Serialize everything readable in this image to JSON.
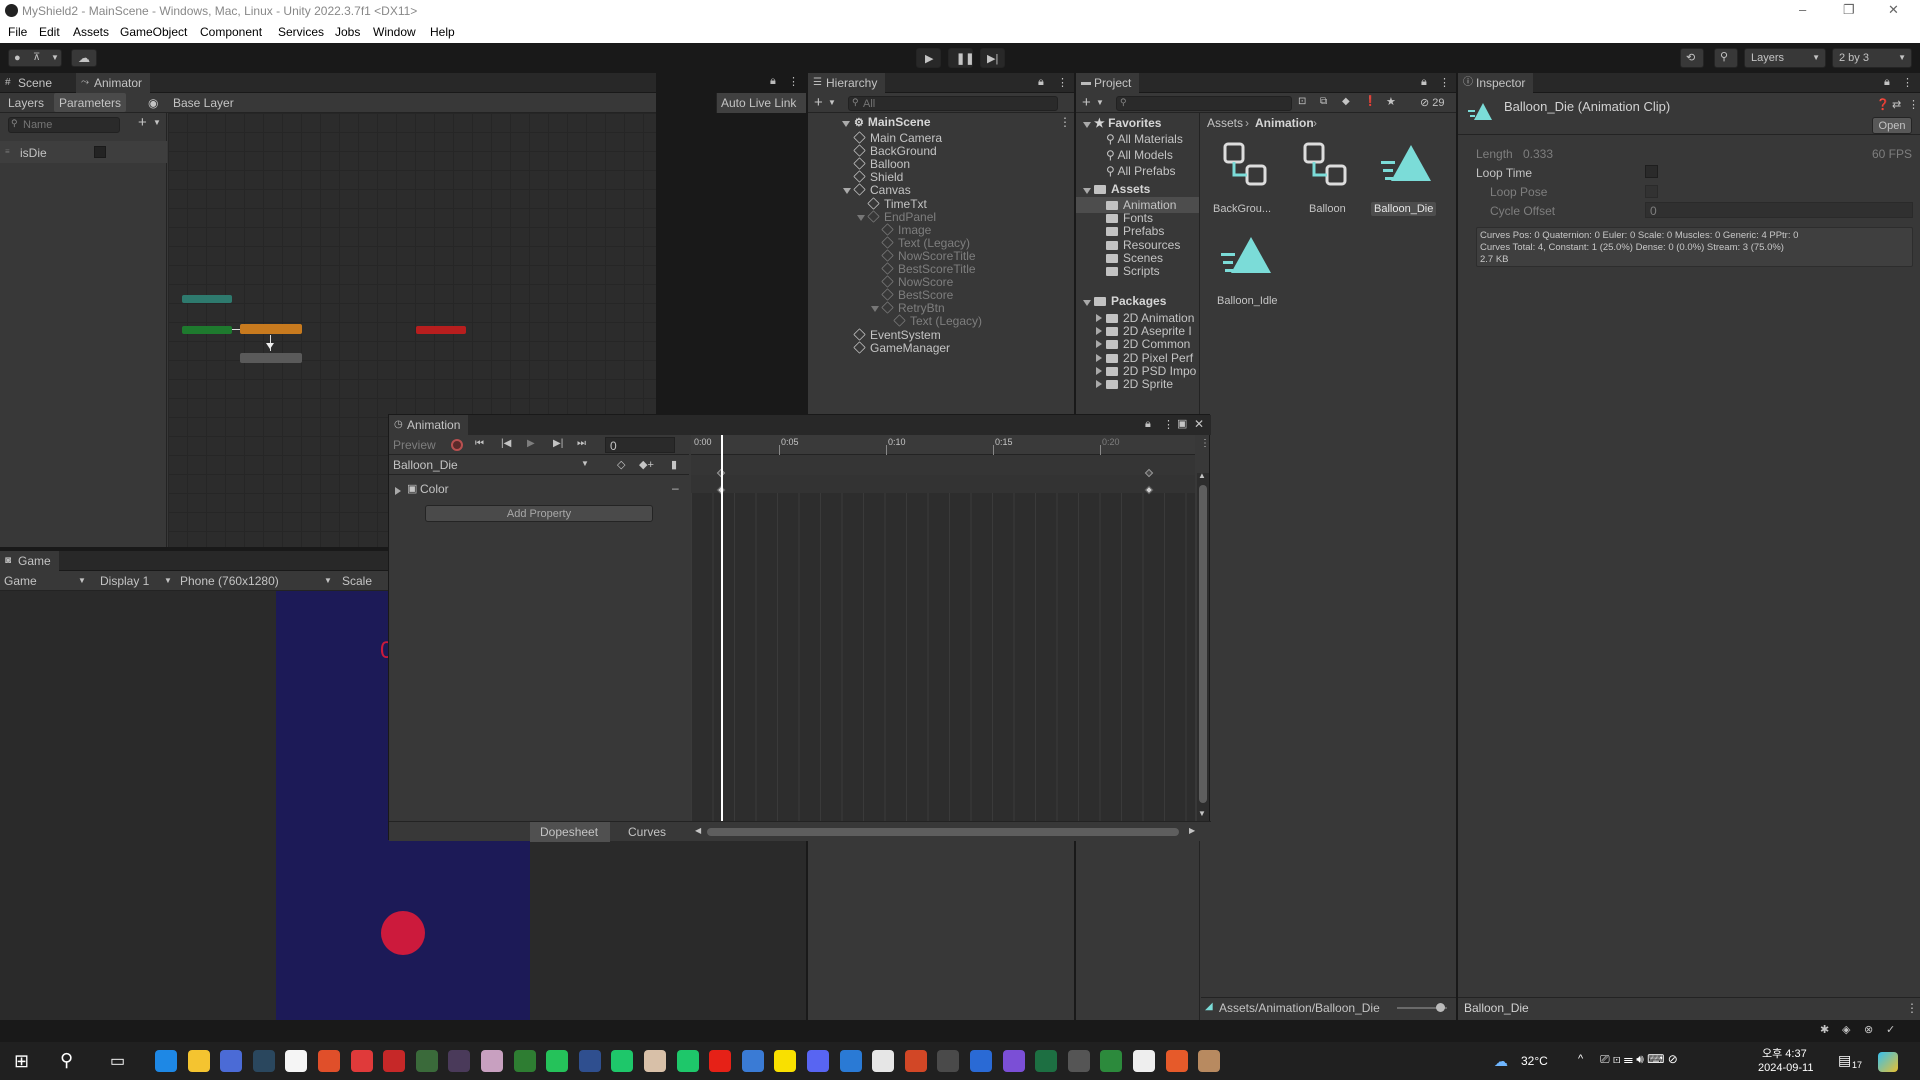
{
  "window": {
    "title": "MyShield2 - MainScene - Windows, Mac, Linux - Unity 2022.3.7f1 <DX11>",
    "controls": [
      "–",
      "❐",
      "✕"
    ]
  },
  "menu": [
    "File",
    "Edit",
    "Assets",
    "GameObject",
    "Component",
    "Services",
    "Jobs",
    "Window",
    "Help"
  ],
  "toolbar": {
    "layers_label": "Layers",
    "layout_label": "2 by 3"
  },
  "scene_tabs": {
    "scene": "Scene",
    "animator": "Animator"
  },
  "animator": {
    "layers_tab": "Layers",
    "parameters_tab": "Parameters",
    "base_layer": "Base Layer",
    "auto_live_link": "Auto Live Link",
    "search_placeholder": "Name",
    "parameter": {
      "name": "isDie",
      "value": false
    }
  },
  "hierarchy": {
    "tab": "Hierarchy",
    "search_placeholder": "All",
    "scene": "MainScene",
    "items": [
      {
        "label": "Main Camera",
        "depth": 1,
        "dim": false
      },
      {
        "label": "BackGround",
        "depth": 1,
        "dim": false
      },
      {
        "label": "Balloon",
        "depth": 1,
        "dim": false
      },
      {
        "label": "Shield",
        "depth": 1,
        "dim": false
      },
      {
        "label": "Canvas",
        "depth": 1,
        "dim": false,
        "expanded": true
      },
      {
        "label": "TimeTxt",
        "depth": 2,
        "dim": false
      },
      {
        "label": "EndPanel",
        "depth": 2,
        "dim": true,
        "expanded": true
      },
      {
        "label": "Image",
        "depth": 3,
        "dim": true
      },
      {
        "label": "Text (Legacy)",
        "depth": 3,
        "dim": true
      },
      {
        "label": "NowScoreTitle",
        "depth": 3,
        "dim": true
      },
      {
        "label": "BestScoreTitle",
        "depth": 3,
        "dim": true
      },
      {
        "label": "NowScore",
        "depth": 3,
        "dim": true
      },
      {
        "label": "BestScore",
        "depth": 3,
        "dim": true
      },
      {
        "label": "RetryBtn",
        "depth": 3,
        "dim": true,
        "expanded": true
      },
      {
        "label": "Text (Legacy)",
        "depth": 4,
        "dim": true
      },
      {
        "label": "EventSystem",
        "depth": 1,
        "dim": false
      },
      {
        "label": "GameManager",
        "depth": 1,
        "dim": false
      }
    ]
  },
  "project": {
    "tab": "Project",
    "hidden_count": "29",
    "favorites": {
      "label": "Favorites",
      "items": [
        "All Materials",
        "All Models",
        "All Prefabs"
      ]
    },
    "assets": {
      "label": "Assets",
      "items": [
        "Animation",
        "Fonts",
        "Prefabs",
        "Resources",
        "Scenes",
        "Scripts"
      ]
    },
    "packages": {
      "label": "Packages",
      "items": [
        "2D Animation",
        "2D Aseprite I",
        "2D Common",
        "2D Pixel Perf",
        "2D PSD Impo",
        "2D Sprite"
      ]
    },
    "breadcrumb": [
      "Assets",
      "Animation"
    ],
    "grid_items": [
      {
        "label": "BackGrou...",
        "kind": "controller"
      },
      {
        "label": "Balloon",
        "kind": "controller"
      },
      {
        "label": "Balloon_Die",
        "kind": "clip",
        "selected": true
      },
      {
        "label": "Balloon_Idle",
        "kind": "clip"
      }
    ],
    "status_path": "Assets/Animation/Balloon_Die"
  },
  "inspector": {
    "tab": "Inspector",
    "title": "Balloon_Die (Animation Clip)",
    "open_button": "Open",
    "length_label": "Length",
    "length_value": "0.333",
    "fps": "60 FPS",
    "loop_time": "Loop Time",
    "loop_pose": "Loop Pose",
    "cycle_offset": "Cycle Offset",
    "cycle_offset_value": "0",
    "info_lines": [
      "Curves Pos: 0 Quaternion: 0 Euler: 0 Scale: 0 Muscles: 0 Generic: 4 PPtr: 0",
      "Curves Total: 4, Constant: 1 (25.0%) Dense: 0 (0.0%) Stream: 3 (75.0%)",
      "2.7 KB"
    ],
    "footer": "Balloon_Die"
  },
  "animation": {
    "tab": "Animation",
    "preview": "Preview",
    "frame": "0",
    "clip": "Balloon_Die",
    "property": "Color",
    "add_property": "Add Property",
    "dopesheet": "Dopesheet",
    "curves": "Curves",
    "time_ticks": [
      "0:00",
      "0:05",
      "0:10",
      "0:15",
      "0:20"
    ]
  },
  "game": {
    "tab": "Game",
    "mode": "Game",
    "display": "Display 1",
    "resolution": "Phone (760x1280)",
    "scale": "Scale",
    "score_glyph": "0"
  },
  "taskbar": {
    "temperature": "32°C",
    "time": "오후 4:37",
    "date": "2024-09-11",
    "notification_count": "17"
  },
  "colors": {
    "accent": "#7bdcd8",
    "game_bg": "#1c1a57",
    "balloon": "#cc1a3c",
    "state_orange": "#c87a1e",
    "state_green": "#1e7a2e",
    "state_teal": "#2e7a6e",
    "state_red": "#b81e1e"
  }
}
